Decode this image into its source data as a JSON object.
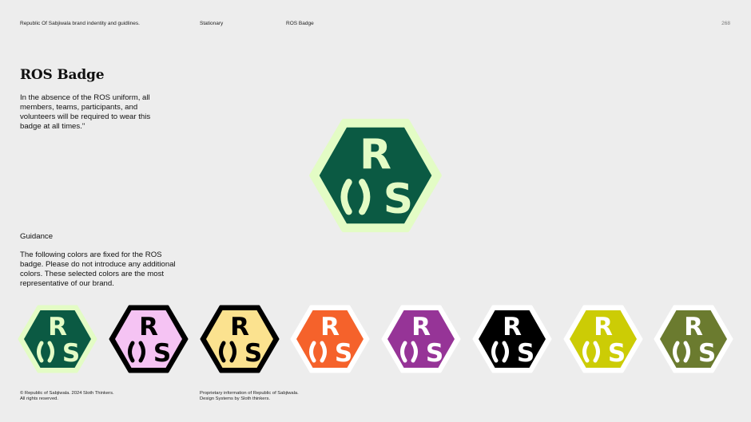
{
  "header": {
    "brand_line": "Republic Of Sabjiwala brand indentity and guidlines.",
    "section": "Stationary",
    "subsection": "ROS Badge",
    "page_number": "268"
  },
  "page_title": "ROS Badge",
  "intro": "In the absence of the ROS uniform, all members, teams, participants, and volunteers will be required to wear this badge at all times.\"",
  "guidance": {
    "heading": "Guidance",
    "text": "The following colors are fixed for the ROS badge. Please do not introduce any additional colors. These selected colors are the most representative of our brand."
  },
  "badge": {
    "letter_top": "R",
    "letter_bottom": "S",
    "main": {
      "fill": "#0b5a43",
      "border": "#e3fcc5",
      "letters": "#e3fcc5"
    },
    "variants": [
      {
        "fill": "#0b5a43",
        "border": "#e3fcc5",
        "letters": "#e3fcc5"
      },
      {
        "fill": "#f5c3f3",
        "border": "#000000",
        "letters": "#000000"
      },
      {
        "fill": "#fbe28f",
        "border": "#000000",
        "letters": "#000000"
      },
      {
        "fill": "#f5622b",
        "border": "#ffffff",
        "letters": "#ffffff"
      },
      {
        "fill": "#963497",
        "border": "#ffffff",
        "letters": "#ffffff"
      },
      {
        "fill": "#000000",
        "border": "#ffffff",
        "letters": "#ffffff"
      },
      {
        "fill": "#cccc05",
        "border": "#ffffff",
        "letters": "#ffffff"
      },
      {
        "fill": "#6b7b2f",
        "border": "#ffffff",
        "letters": "#ffffff"
      }
    ]
  },
  "footer": {
    "copyright_line1": "© Republic of Sabjiwala. 2024 Sloth Thinkers.",
    "copyright_line2": "All rights reserved.",
    "proprietary_line1": "Proprietary information of Republic of Sabjiwala.",
    "proprietary_line2": "Design Systems by Sloth thinkers."
  }
}
